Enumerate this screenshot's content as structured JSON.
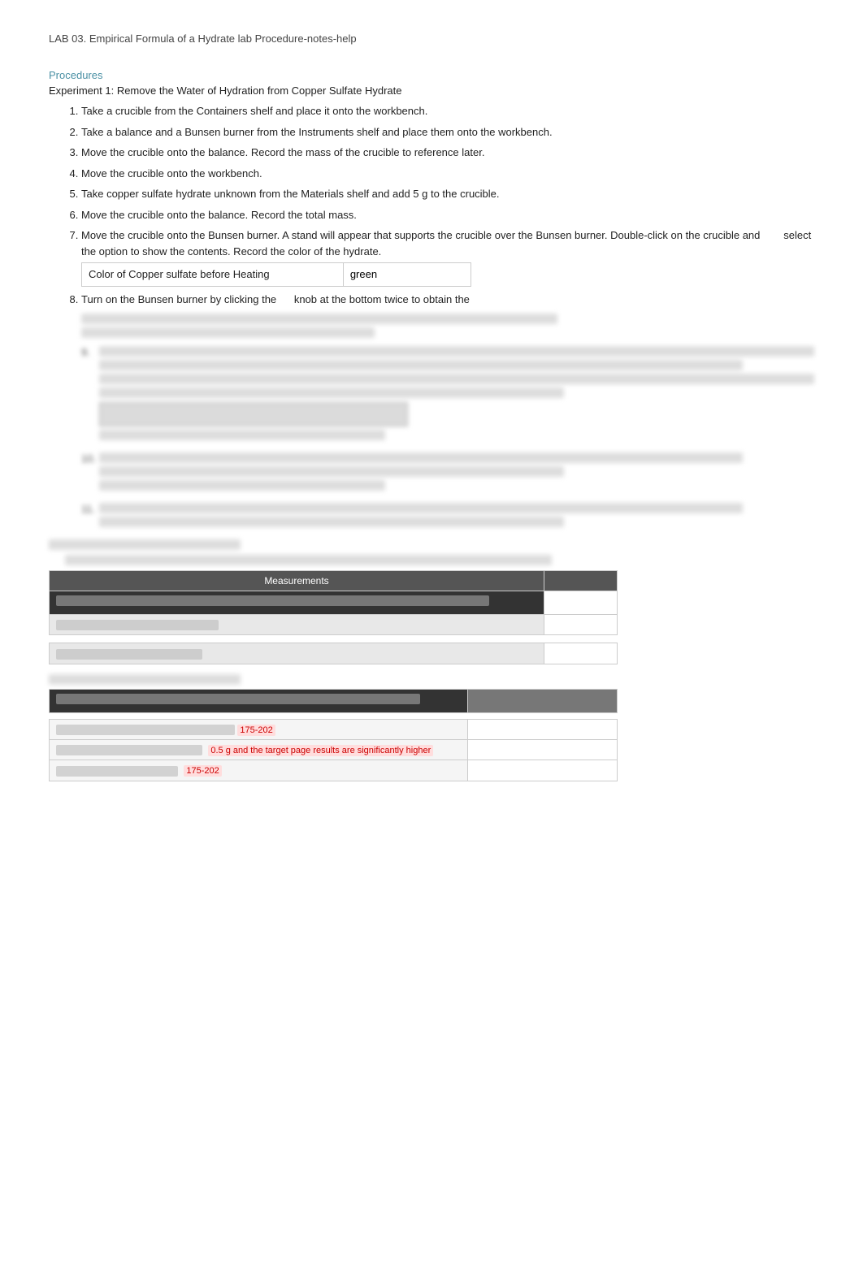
{
  "page": {
    "title": "LAB 03. Empirical Formula of a Hydrate lab Procedure-notes-help",
    "sections_heading": "Procedures",
    "experiment1": {
      "title": "Experiment 1: Remove the Water of Hydration from Copper Sulfate Hydrate",
      "steps": [
        "Take a crucible from the Containers shelf and place it onto the workbench.",
        "Take a balance and a Bunsen burner from the Instruments shelf and place them onto the workbench.",
        "Move the crucible onto the balance. Record the mass of the crucible to reference later.",
        "Move the crucible onto the workbench.",
        "Take copper sulfate hydrate unknown from the Materials shelf and add 5 g to the crucible.",
        "Move the crucible onto the balance. Record the total mass.",
        "Move the crucible onto the Bunsen burner. A stand will appear that supports the crucible over the Bunsen burner. Double-click on the crucible and       select the option to show the contents. Record the color of the hydrate.",
        "Turn on the Bunsen burner by clicking the      knob at the bottom twice to obtain the"
      ],
      "color_table": {
        "label": "Color of Copper sulfate before Heating",
        "value": "green"
      }
    },
    "experiment2_title": "Experiment 2: The Lab Procedure",
    "blurred_steps_text": [
      "blurred step text line 1",
      "blurred step text line 2",
      "blurred step text line 3"
    ],
    "data_tables": {
      "table1": {
        "header": "Measurements",
        "rows": [
          {
            "label": "Mass of the crucible (g)",
            "value": ""
          },
          {
            "label": "Mass of crucible and contents (g)",
            "value": ""
          }
        ]
      },
      "section_label": "Calculate the following:",
      "calc_rows": [
        {
          "label": "Mass of Copper sulfate hydrate / sample (g)",
          "value": ""
        },
        {
          "label": "What if table 1 The Bunsen sample (g)",
          "value_red": true,
          "value": "175-202"
        },
        {
          "label": "What if table 2 moles 1 The sample should be 2 The results are significantly higher",
          "value_red": true,
          "value": "0.5 g and the target page"
        },
        {
          "label": "The moles of 1 The sample is",
          "value_red": true,
          "value": "175-202"
        }
      ]
    }
  }
}
